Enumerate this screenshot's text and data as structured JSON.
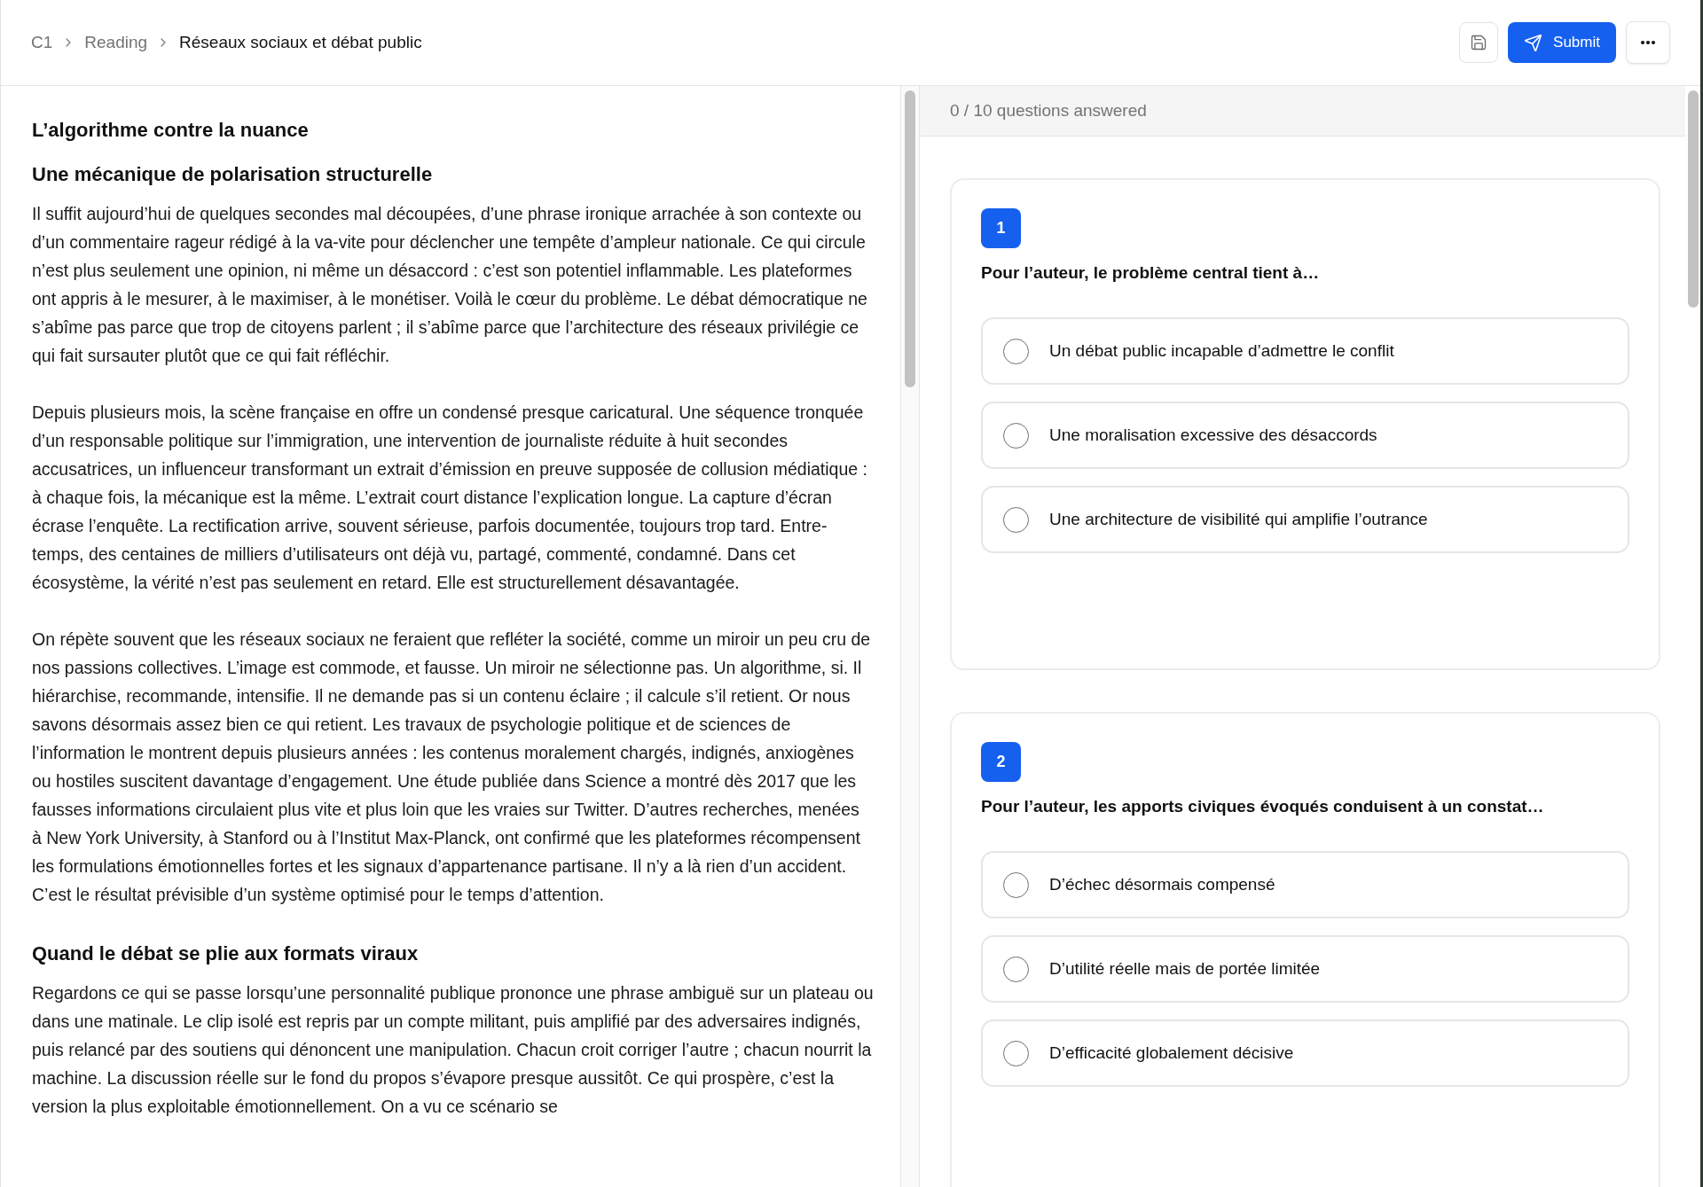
{
  "breadcrumb": [
    {
      "label": "C1",
      "current": false
    },
    {
      "label": "Reading",
      "current": false
    },
    {
      "label": "Réseaux sociaux et débat public",
      "current": true
    }
  ],
  "actions": [
    {
      "kind": "save"
    },
    {
      "kind": "submit",
      "label": "Submit"
    },
    {
      "kind": "more"
    }
  ],
  "article": {
    "title": "L’algorithme contre la nuance",
    "sections": [
      {
        "heading": "Une mécanique de polarisation structurelle",
        "paragraphs": [
          "Il suffit aujourd’hui de quelques secondes mal découpées, d’une phrase ironique arrachée à son contexte ou d’un commentaire rageur rédigé à la va-vite pour déclencher une tempête d’ampleur nationale. Ce qui circule n’est plus seulement une opinion, ni même un désaccord : c’est son potentiel inflammable. Les plateformes ont appris à le mesurer, à le maximiser, à le monétiser. Voilà le cœur du problème. Le débat démocratique ne s’abîme pas parce que trop de citoyens parlent ; il s’abîme parce que l’architecture des réseaux privilégie ce qui fait sursauter plutôt que ce qui fait réfléchir.",
          "Depuis plusieurs mois, la scène française en offre un condensé presque caricatural. Une séquence tronquée d’un responsable politique sur l’immigration, une intervention de journaliste réduite à huit secondes accusatrices, un influenceur transformant un extrait d’émission en preuve supposée de collusion médiatique : à chaque fois, la mécanique est la même. L’extrait court distance l’explication longue. La capture d’écran écrase l’enquête. La rectification arrive, souvent sérieuse, parfois documentée, toujours trop tard. Entre-temps, des centaines de milliers d’utilisateurs ont déjà vu, partagé, commenté, condamné. Dans cet écosystème, la vérité n’est pas seulement en retard. Elle est structurellement désavantagée.",
          "On répète souvent que les réseaux sociaux ne feraient que refléter la société, comme un miroir un peu cru de nos passions collectives. L’image est commode, et fausse. Un miroir ne sélectionne pas. Un algorithme, si. Il hiérarchise, recommande, intensifie. Il ne demande pas si un contenu éclaire ; il calcule s’il retient. Or nous savons désormais assez bien ce qui retient. Les travaux de psychologie politique et de sciences de l’information le montrent depuis plusieurs années : les contenus moralement chargés, indignés, anxiogènes ou hostiles suscitent davantage d’engagement. Une étude publiée dans Science a montré dès 2017 que les fausses informations circulaient plus vite et plus loin que les vraies sur Twitter. D’autres recherches, menées à New York University, à Stanford ou à l’Institut Max-Planck, ont confirmé que les plateformes récompensent les formulations émotionnelles fortes et les signaux d’appartenance partisane. Il n’y a là rien d’un accident. C’est le résultat prévisible d’un système optimisé pour le temps d’attention."
        ]
      },
      {
        "heading": "Quand le débat se plie aux formats viraux",
        "paragraphs": [
          "Regardons ce qui se passe lorsqu’une personnalité publique prononce une phrase ambiguë sur un plateau ou dans une matinale. Le clip isolé est repris par un compte militant, puis amplifié par des adversaires indignés, puis relancé par des soutiens qui dénoncent une manipulation. Chacun croit corriger l’autre ; chacun nourrit la machine. La discussion réelle sur le fond du propos s’évapore presque aussitôt. Ce qui prospère, c’est la version la plus exploitable émotionnellement. On a vu ce scénario se"
        ]
      }
    ]
  },
  "progress": {
    "text": "0 / 10 questions answered"
  },
  "questions": [
    {
      "number": "1",
      "prompt": "Pour l’auteur, le problème central tient à…",
      "options": [
        {
          "label": "Un débat public incapable d’admettre le conflit",
          "selected": false
        },
        {
          "label": "Une moralisation excessive des désaccords",
          "selected": false
        },
        {
          "label": "Une architecture de visibilité qui amplifie l’outrance",
          "selected": false
        }
      ]
    },
    {
      "number": "2",
      "prompt": "Pour l’auteur, les apports civiques évoqués conduisent à un constat…",
      "options": [
        {
          "label": "D’échec désormais compensé",
          "selected": false
        },
        {
          "label": "D’utilité réelle mais de portée limitée",
          "selected": false
        },
        {
          "label": "D’efficacité globalement décisive",
          "selected": false
        }
      ]
    }
  ]
}
